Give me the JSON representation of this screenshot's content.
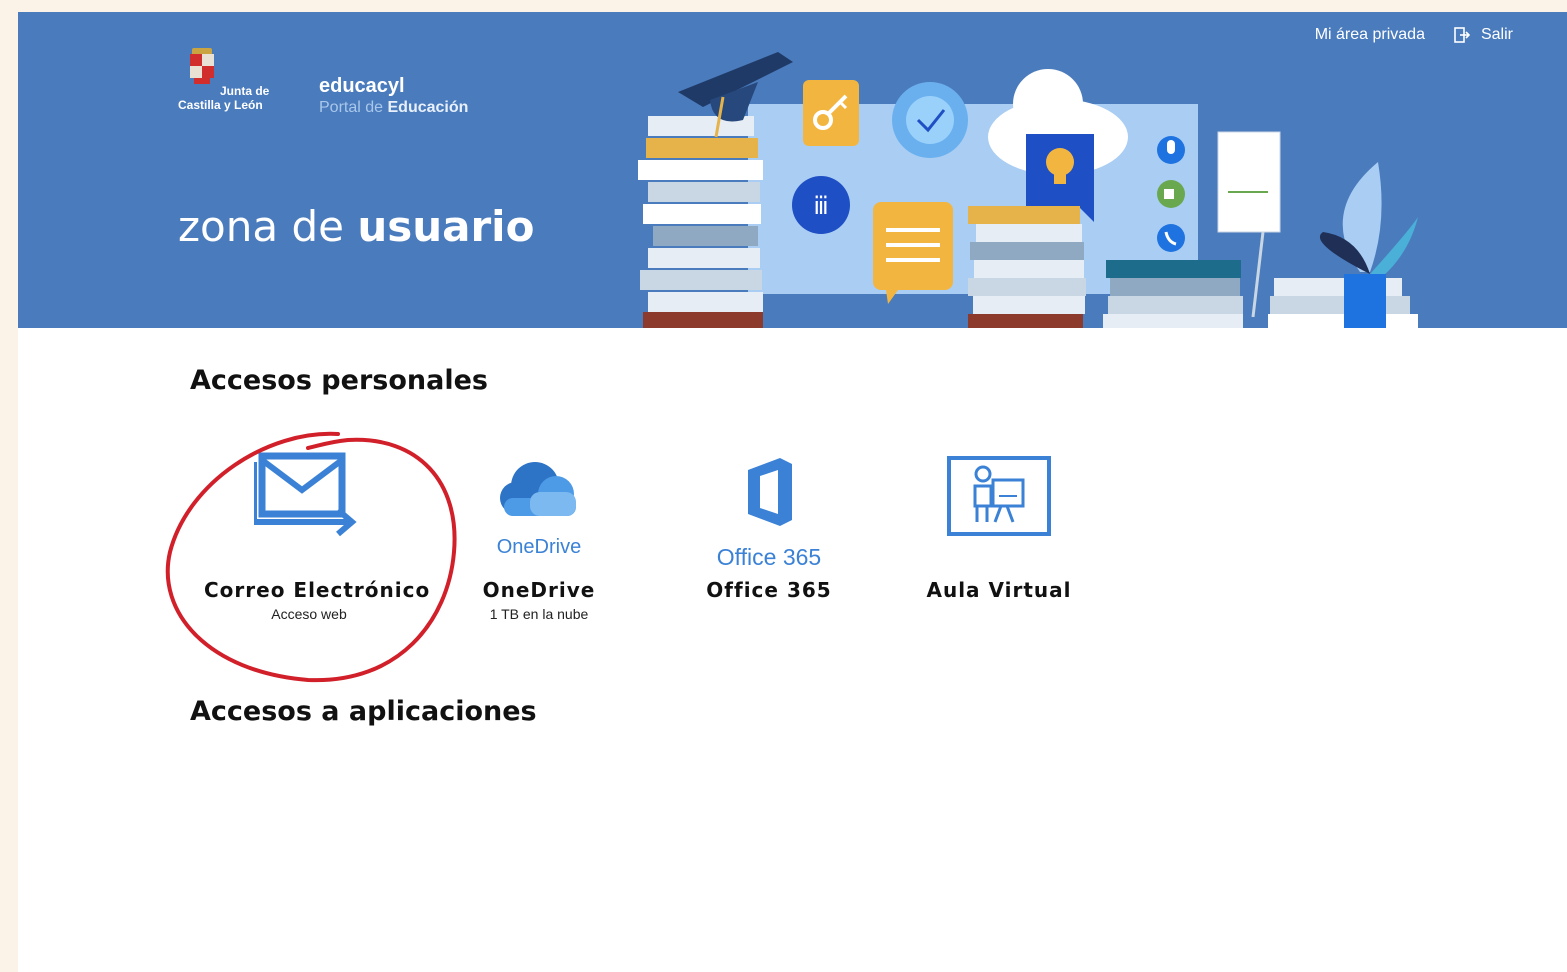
{
  "header": {
    "jcyl_line1": "Junta de",
    "jcyl_line2": "Castilla y León",
    "brand_name": "educacyl",
    "brand_sub_prefix": "Portal de",
    "brand_sub_strong": "Educación",
    "zona_prefix": "zona de",
    "zona_strong": "usuario",
    "links": {
      "private_area": "Mi área privada",
      "logout": "Salir"
    }
  },
  "sections": {
    "personal": "Accesos personales",
    "apps": "Accesos a aplicaciones"
  },
  "tiles": [
    {
      "label": "Correo Electrónico",
      "sub": "Acceso web",
      "icon": "email-forward-icon"
    },
    {
      "label": "OneDrive",
      "sub": "1 TB en la nube",
      "icon_text": "OneDrive",
      "icon": "onedrive-cloud-icon"
    },
    {
      "label": "Office 365",
      "sub": "",
      "icon_text": "Office 365",
      "icon": "office365-icon"
    },
    {
      "label": "Aula Virtual",
      "sub": "",
      "icon": "virtual-classroom-icon"
    }
  ],
  "colors": {
    "header_blue": "#4a7bbd",
    "icon_blue": "#3b82d6",
    "annotation_red": "#d1202a"
  }
}
